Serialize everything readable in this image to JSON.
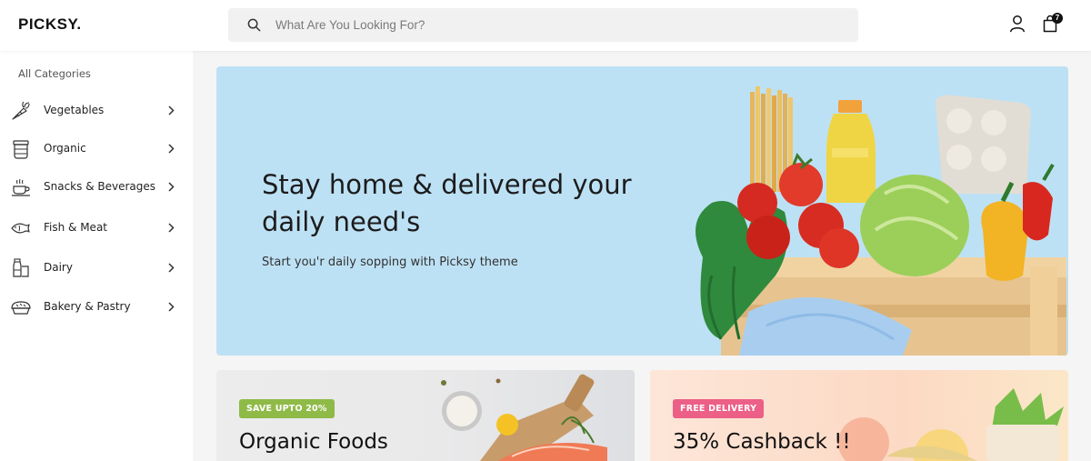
{
  "header": {
    "logo": "PICKSY.",
    "search_placeholder": "What Are You Looking For?",
    "cart_count": "7"
  },
  "sidebar": {
    "title": "All Categories",
    "items": [
      {
        "label": "Vegetables",
        "icon": "carrot-icon"
      },
      {
        "label": "Organic",
        "icon": "jar-icon"
      },
      {
        "label": "Snacks & Beverages",
        "icon": "coffee-cup-icon"
      },
      {
        "label": "Fish & Meat",
        "icon": "fish-icon"
      },
      {
        "label": "Dairy",
        "icon": "milk-bottle-icon"
      },
      {
        "label": "Bakery & Pastry",
        "icon": "bread-icon"
      }
    ]
  },
  "hero": {
    "title": "Stay home & delivered your daily need's",
    "subtitle": "Start you'r daily sopping with Picksy theme",
    "background": "#bde1f4"
  },
  "promos": [
    {
      "badge": "SAVE UPTO 20%",
      "title": "Organic Foods",
      "badge_color": "#8fba48"
    },
    {
      "badge": "FREE DELIVERY",
      "title": "35% Cashback !!",
      "badge_color": "#ec5f87"
    }
  ]
}
